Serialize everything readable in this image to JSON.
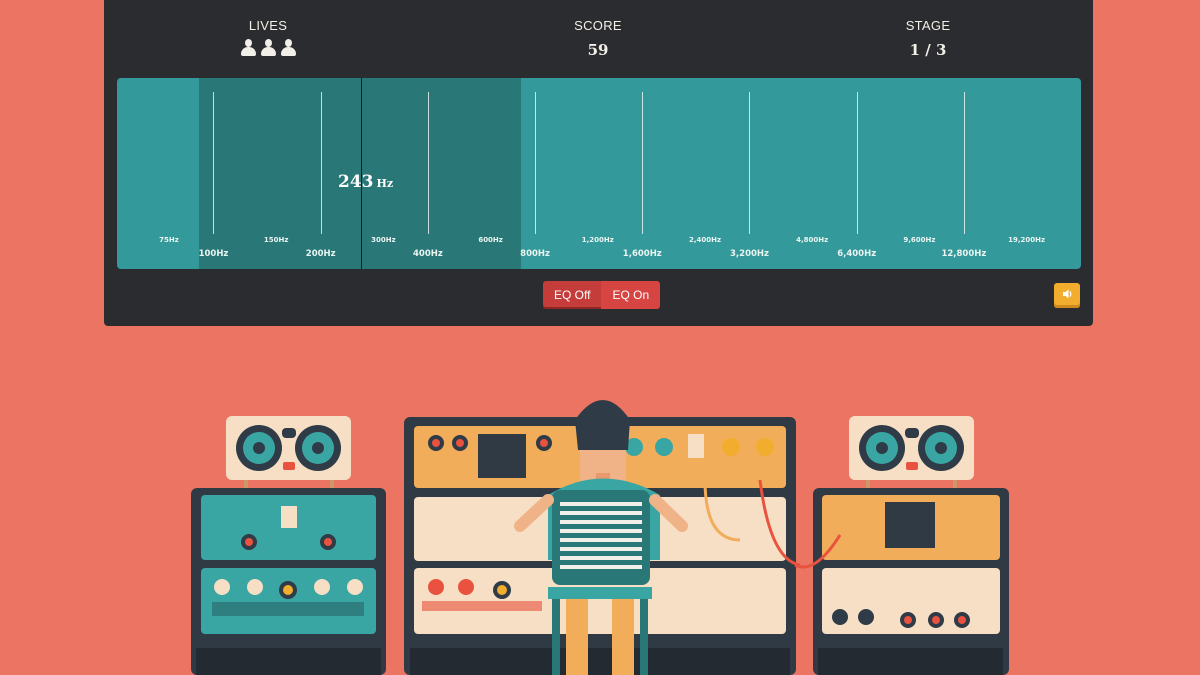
{
  "hud": {
    "lives_label": "LIVES",
    "lives_count": 3,
    "score_label": "SCORE",
    "score_value": "59",
    "stage_label": "STAGE",
    "stage_value": "1 / 3"
  },
  "spectrum": {
    "readout_value": "243",
    "readout_unit": "Hz",
    "small_labels": [
      "75Hz",
      "150Hz",
      "300Hz",
      "600Hz",
      "1,200Hz",
      "2,400Hz",
      "4,800Hz",
      "9,600Hz",
      "19,200Hz"
    ],
    "big_labels": [
      "100Hz",
      "200Hz",
      "400Hz",
      "800Hz",
      "1,600Hz",
      "3,200Hz",
      "6,400Hz",
      "12,800Hz"
    ]
  },
  "controls": {
    "eq_off_label": "EQ Off",
    "eq_on_label": "EQ On",
    "sound_icon": "speaker-icon"
  },
  "colors": {
    "background": "#ec7463",
    "panel": "#2b2c2f",
    "spectrum": "#34999a",
    "selected_band": "#2a7778",
    "eq_button": "#d64542",
    "sound_button": "#f2ad2f"
  }
}
